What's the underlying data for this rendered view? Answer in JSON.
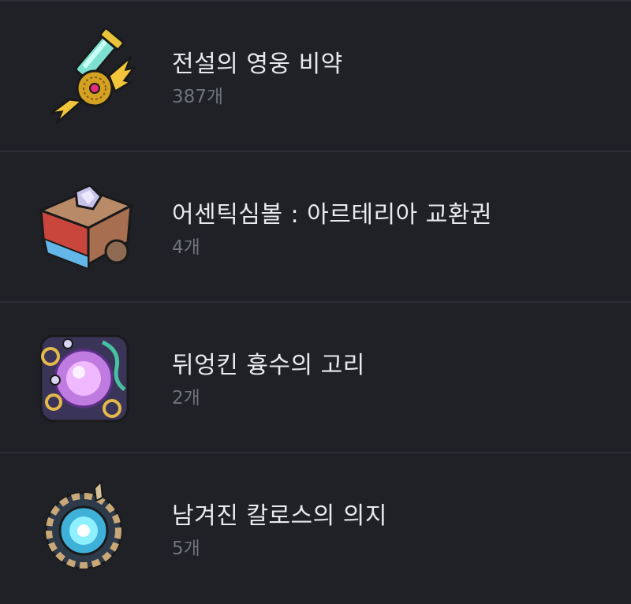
{
  "items": [
    {
      "name": "전설의 영웅 비약",
      "count": "387개",
      "icon": "potion-wing-icon"
    },
    {
      "name": "어센틱심볼 : 아르테리아 교환권",
      "count": "4개",
      "icon": "symbol-box-icon"
    },
    {
      "name": "뒤엉킨 흉수의 고리",
      "count": "2개",
      "icon": "tangled-orb-icon"
    },
    {
      "name": "남겨진 칼로스의 의지",
      "count": "5개",
      "icon": "kalos-will-icon"
    }
  ],
  "colors": {
    "background": "#1f2127",
    "divider": "#2c2f36",
    "name_text": "#e9eaee",
    "count_text": "#70737b"
  }
}
